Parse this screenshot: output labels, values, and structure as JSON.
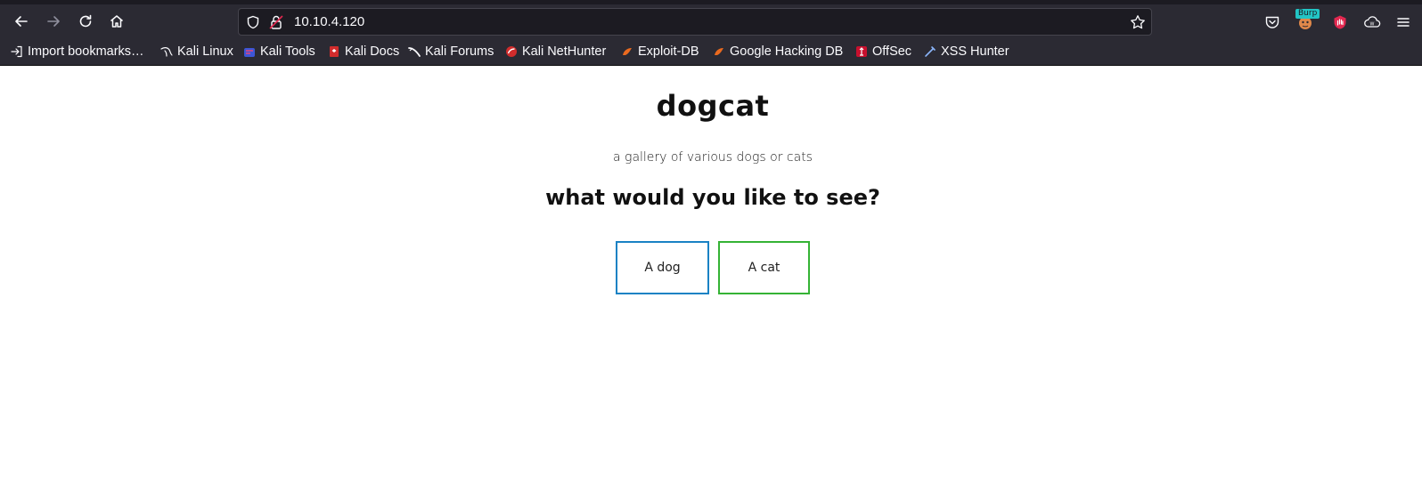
{
  "browser": {
    "url": "10.10.4.120",
    "extension_badge": "Burp",
    "bookmarks": [
      {
        "label": "Import bookmarks…",
        "icon": "import-icon"
      },
      {
        "label": "Kali Linux",
        "icon": "kali-dragon-icon"
      },
      {
        "label": "Kali Tools",
        "icon": "kali-tools-icon"
      },
      {
        "label": "Kali Docs",
        "icon": "kali-docs-icon"
      },
      {
        "label": "Kali Forums",
        "icon": "kali-forums-icon"
      },
      {
        "label": "Kali NetHunter",
        "icon": "nethunter-icon"
      },
      {
        "label": "Exploit-DB",
        "icon": "exploit-db-icon"
      },
      {
        "label": "Google Hacking DB",
        "icon": "ghdb-icon"
      },
      {
        "label": "OffSec",
        "icon": "offsec-icon"
      },
      {
        "label": "XSS Hunter",
        "icon": "xss-hunter-icon"
      }
    ]
  },
  "page": {
    "title": "dogcat",
    "subtitle": "a gallery of various dogs or cats",
    "question": "what would you like to see?",
    "buttons": {
      "dog": "A dog",
      "cat": "A cat"
    }
  },
  "colors": {
    "chrome_bg": "#2b2a33",
    "urlbar_bg": "#1c1b22",
    "dog_border": "#1a82c4",
    "cat_border": "#35b335"
  }
}
